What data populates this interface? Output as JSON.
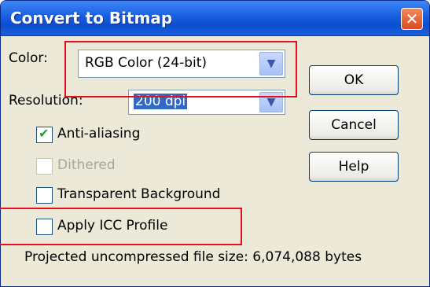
{
  "window": {
    "title": "Convert to Bitmap",
    "close_label": "✕"
  },
  "color": {
    "label": "Color:",
    "value": "RGB Color (24-bit)"
  },
  "resolution": {
    "label": "Resolution:",
    "value": "200 dpi"
  },
  "options": {
    "anti_aliasing": {
      "label": "Anti-aliasing",
      "checked": true
    },
    "dithered": {
      "label": "Dithered",
      "checked": false,
      "disabled": true
    },
    "transparent_background": {
      "label": "Transparent Background",
      "checked": false
    },
    "apply_icc_profile": {
      "label": "Apply ICC Profile",
      "checked": false
    }
  },
  "buttons": {
    "ok": "OK",
    "cancel": "Cancel",
    "help": "Help"
  },
  "file_size_text": "Projected uncompressed file size: 6,074,088 bytes",
  "colors": {
    "title_blue": "#0b4fd1",
    "highlight_red": "#e3101f",
    "checkmark_green": "#21a121"
  }
}
